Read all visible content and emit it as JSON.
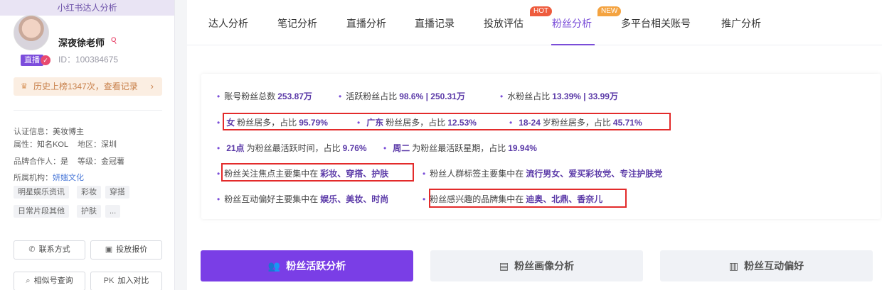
{
  "sidebar": {
    "banner": "小红书达人分析",
    "nickname": "深夜徐老师",
    "uid": "ID：100384675",
    "live_badge": "直播",
    "history": "历史上榜1347次，查看记录",
    "info": {
      "cert_k": "认证信息：",
      "cert_v": "美妆博主",
      "attr_k": "属性：",
      "attr_v": "知名KOL",
      "region_k": "地区：",
      "region_v": "深圳",
      "brand_k": "品牌合作人：",
      "brand_v": "是",
      "level_k": "等级：",
      "level_v": "金冠薯",
      "org_k": "所属机构：",
      "org_v": "妍媸文化"
    },
    "tags": [
      "明星娱乐资讯",
      "彩妆",
      "穿搭",
      "日常片段其他",
      "护肤",
      "..."
    ],
    "buttons": {
      "contact": "联系方式",
      "quote": "投放报价",
      "similar": "相似号查询",
      "compare": "加入对比",
      "pk": "PK"
    }
  },
  "tabs": [
    "达人分析",
    "笔记分析",
    "直播分析",
    "直播记录",
    "投放评估",
    "粉丝分析",
    "多平台相关账号",
    "推广分析"
  ],
  "badges": {
    "hot": "HOT",
    "new": "NEW"
  },
  "summary": {
    "r1": {
      "a_t": "账号粉丝总数",
      "a_v": "253.87万",
      "b_t": "活跃粉丝占比",
      "b_v": "98.6% | 250.31万",
      "c_t": "水粉丝占比",
      "c_v": "13.39% | 33.99万"
    },
    "r2": {
      "a_b": "女",
      "a_t": "粉丝居多，占比",
      "a_v": "95.79%",
      "b_b": "广东",
      "b_t": "粉丝居多，占比",
      "b_v": "12.53%",
      "c_b": "18-24",
      "c_t": "岁粉丝居多，占比",
      "c_v": "45.71%"
    },
    "r3": {
      "a_b": "21点",
      "a_t": "为粉丝最活跃时间，占比",
      "a_v": "9.76%",
      "b_b": "周二",
      "b_t": "为粉丝最活跃星期，占比",
      "b_v": "19.94%"
    },
    "r4": {
      "a_t": "粉丝关注焦点主要集中在",
      "a_v": "彩妆、穿搭、护肤",
      "b_t": "粉丝人群标签主要集中在",
      "b_v": "流行男女、爱买彩妆党、专注护肤党"
    },
    "r5": {
      "a_t": "粉丝互动偏好主要集中在",
      "a_v": "娱乐、美妆、时尚",
      "b_t": "粉丝感兴趣的品牌集中在",
      "b_v": "迪奥、北鼎、香奈儿"
    }
  },
  "segments": [
    "粉丝活跃分析",
    "粉丝画像分析",
    "粉丝互动偏好"
  ]
}
